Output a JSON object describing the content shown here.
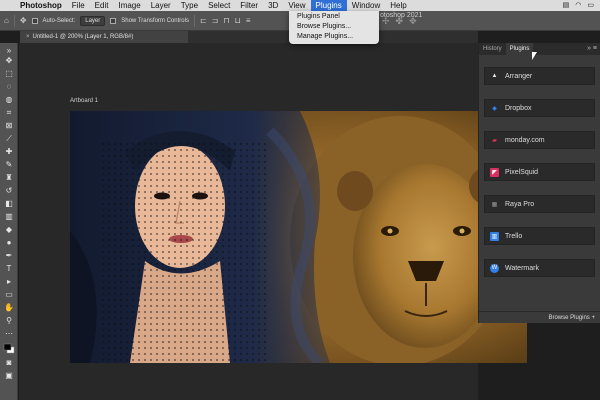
{
  "menubar": {
    "apple": "",
    "items": [
      "Photoshop",
      "File",
      "Edit",
      "Image",
      "Layer",
      "Type",
      "Select",
      "Filter",
      "3D",
      "View",
      "Plugins",
      "Window",
      "Help"
    ],
    "active": "Plugins",
    "status_icons": [
      "control-center-icon",
      "wifi-icon",
      "battery-icon"
    ]
  },
  "plugins_menu": {
    "items": [
      "Plugins Panel",
      "Browse Plugins...",
      "Manage Plugins..."
    ]
  },
  "window_title": "otoshop 2021",
  "options_bar": {
    "auto_select_label": "Auto-Select:",
    "layer_select": "Layer",
    "show_transform_label": "Show Transform Controls"
  },
  "document_tab": {
    "title": "Untitled-1 @ 200% (Layer 1, RGB/8#)"
  },
  "artboard": {
    "label": "Artboard 1"
  },
  "panel": {
    "tabs": [
      "History",
      "Plugins"
    ],
    "active_tab": "Plugins",
    "plugins": [
      {
        "name": "Arranger",
        "icon": "arranger-icon",
        "color": "#e8e8e8"
      },
      {
        "name": "Dropbox",
        "icon": "dropbox-icon",
        "color": "#2f7fe6"
      },
      {
        "name": "monday.com",
        "icon": "monday-icon",
        "color": "#e3345a"
      },
      {
        "name": "PixelSquid",
        "icon": "pixelsquid-icon",
        "color": "#d9305f"
      },
      {
        "name": "Raya Pro",
        "icon": "raya-pro-icon",
        "color": "#9a9a9a"
      },
      {
        "name": "Trello",
        "icon": "trello-icon",
        "color": "#2f7fe6"
      },
      {
        "name": "Watermark",
        "icon": "watermark-icon",
        "color": "#2f7fe6"
      }
    ],
    "footer": "Browse Plugins"
  },
  "colors": {
    "menu_highlight": "#2f6fd6",
    "app_bg": "#535353",
    "canvas_bg": "#282828",
    "panel_bg": "#3a3a3a"
  }
}
